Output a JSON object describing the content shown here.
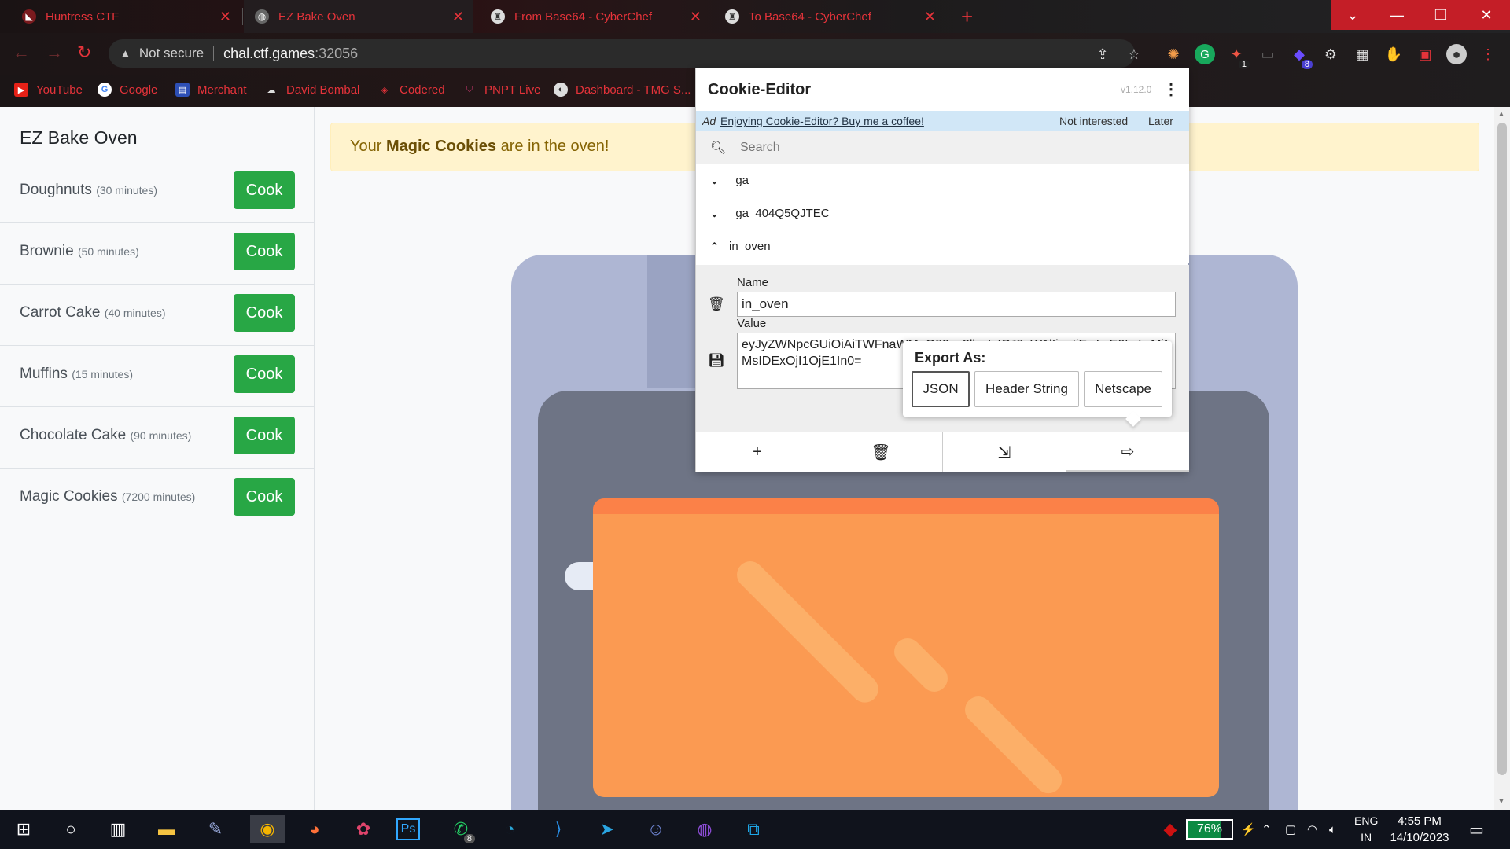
{
  "browser": {
    "tabs": [
      {
        "title": "Huntress CTF"
      },
      {
        "title": "EZ Bake Oven"
      },
      {
        "title": "From Base64 - CyberChef"
      },
      {
        "title": "To Base64 - CyberChef"
      }
    ],
    "new_tab": "+",
    "address": {
      "security": "Not secure",
      "host": "chal.ctf.games",
      "port": ":32056"
    },
    "bookmarks": [
      {
        "label": "YouTube"
      },
      {
        "label": "Google"
      },
      {
        "label": "Merchant"
      },
      {
        "label": "David Bombal"
      },
      {
        "label": "Codered"
      },
      {
        "label": "PNPT Live"
      },
      {
        "label": "Dashboard - TMG S..."
      }
    ],
    "extension_badges": {
      "first": "1",
      "second": "8"
    },
    "accent": "#e5333a"
  },
  "sidebar": {
    "title": "EZ Bake Oven",
    "items": [
      {
        "name": "Doughnuts",
        "time": "(30 minutes)",
        "button": "Cook"
      },
      {
        "name": "Brownie",
        "time": "(50 minutes)",
        "button": "Cook"
      },
      {
        "name": "Carrot Cake",
        "time": "(40 minutes)",
        "button": "Cook"
      },
      {
        "name": "Muffins",
        "time": "(15 minutes)",
        "button": "Cook"
      },
      {
        "name": "Chocolate Cake",
        "time": "(90 minutes)",
        "button": "Cook"
      },
      {
        "name": "Magic Cookies",
        "time": "(7200 minutes)",
        "button": "Cook"
      }
    ]
  },
  "alert": {
    "prefix": "Your ",
    "highlight": "Magic Cookies",
    "suffix": " are in the oven!"
  },
  "cookie_editor": {
    "title": "Cookie-Editor",
    "version": "v1.12.0",
    "ad": {
      "tag": "Ad",
      "link": "Enjoying Cookie-Editor? Buy me a coffee!",
      "dismiss": "Not interested",
      "later": "Later"
    },
    "search_placeholder": "Search",
    "cookies": [
      {
        "name": "_ga",
        "expanded": false
      },
      {
        "name": "_ga_404Q5QJTEC",
        "expanded": false
      },
      {
        "name": "in_oven",
        "expanded": true
      }
    ],
    "detail": {
      "name_label": "Name",
      "name_value": "in_oven",
      "value_label": "Value",
      "value_line1": "eyJyZWNpcGUiOiAiTWFnaWMgQ29va2llcyIsICJ0aW1lIjogIjEwLzE0LzIwMjMsIDExOjI1OjE1In0=",
      "value_line2": "MsIDExOjI1OjE1In0="
    },
    "export": {
      "title": "Export As:",
      "options": [
        "JSON",
        "Header String",
        "Netscape"
      ]
    }
  },
  "taskbar": {
    "battery_percent": "76%",
    "battery_level": 0.76,
    "lang_1": "ENG",
    "lang_2": "IN",
    "time": "4:55 PM",
    "date": "14/10/2023",
    "badges": {
      "whatsapp": "8"
    }
  }
}
